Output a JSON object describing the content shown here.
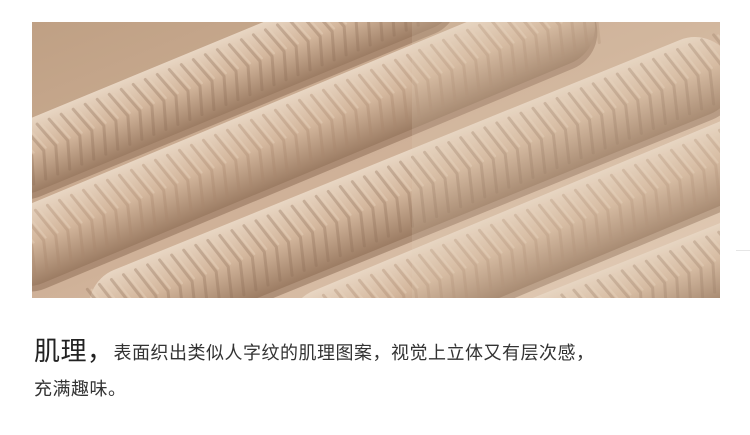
{
  "photo": {
    "icon": "knit-fabric-closeup-image",
    "colors": {
      "base": "#c9a98e",
      "light": "#e6d2bd",
      "mid": "#d3b69c",
      "dark": "#a8876d",
      "shadow": "#8f6f58"
    }
  },
  "caption": {
    "heading": "肌理，",
    "body_line1": "表面织出类似人字纹的肌理图案，视觉上立体又有层次感，",
    "body_line2": "充满趣味。"
  }
}
